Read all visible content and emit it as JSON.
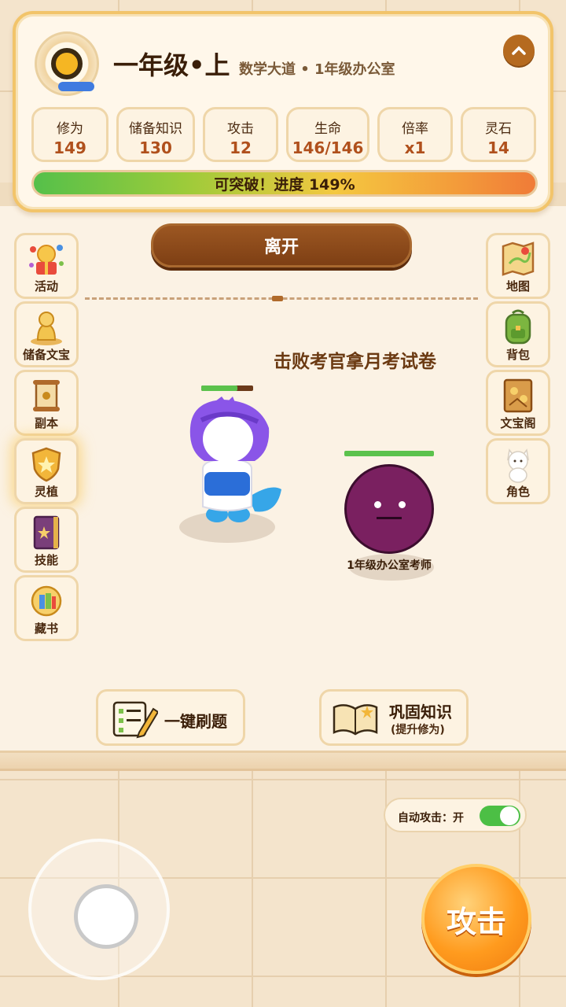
{
  "header": {
    "rank_title": "一年级•上",
    "location": "数学大道 • 1年级办公室",
    "collapse_icon": "chevron-up-icon",
    "stats": [
      {
        "label": "修为",
        "value": "149"
      },
      {
        "label": "储备知识",
        "value": "130"
      },
      {
        "label": "攻击",
        "value": "12"
      },
      {
        "label": "生命",
        "value": "146/146"
      },
      {
        "label": "倍率",
        "value": "x1"
      },
      {
        "label": "灵石",
        "value": "14"
      }
    ],
    "progress": {
      "text": "可突破！进度 149%",
      "percent": 149
    }
  },
  "leave_button": "离开",
  "objective": "击败考官拿月考试卷",
  "left_menu": [
    {
      "label": "活动",
      "icon": "event-gift-icon"
    },
    {
      "label": "储备文宝",
      "icon": "golden-figure-icon"
    },
    {
      "label": "副本",
      "icon": "scroll-icon"
    },
    {
      "label": "灵植",
      "icon": "star-shield-icon"
    },
    {
      "label": "技能",
      "icon": "skill-book-icon"
    },
    {
      "label": "藏书",
      "icon": "book-collection-icon"
    }
  ],
  "right_menu": [
    {
      "label": "地图",
      "icon": "map-icon"
    },
    {
      "label": "背包",
      "icon": "backpack-icon"
    },
    {
      "label": "文宝阁",
      "icon": "treasure-book-icon"
    },
    {
      "label": "角色",
      "icon": "cat-character-icon"
    }
  ],
  "player": {
    "hp_fraction": 0.7
  },
  "enemy": {
    "name": "1年级办公室考师",
    "hp_fraction": 1.0
  },
  "actions": {
    "quick_quiz": "一键刷题",
    "consolidate": "巩固知识",
    "consolidate_sub": "(提升修为)"
  },
  "auto_attack": {
    "label": "自动攻击：开",
    "enabled": true
  },
  "attack_button": "攻击",
  "colors": {
    "accent_brown": "#7e3f14",
    "attack_orange": "#ff9b1e",
    "enemy_purple": "#7a2060",
    "toggle_green": "#4cbf45"
  }
}
